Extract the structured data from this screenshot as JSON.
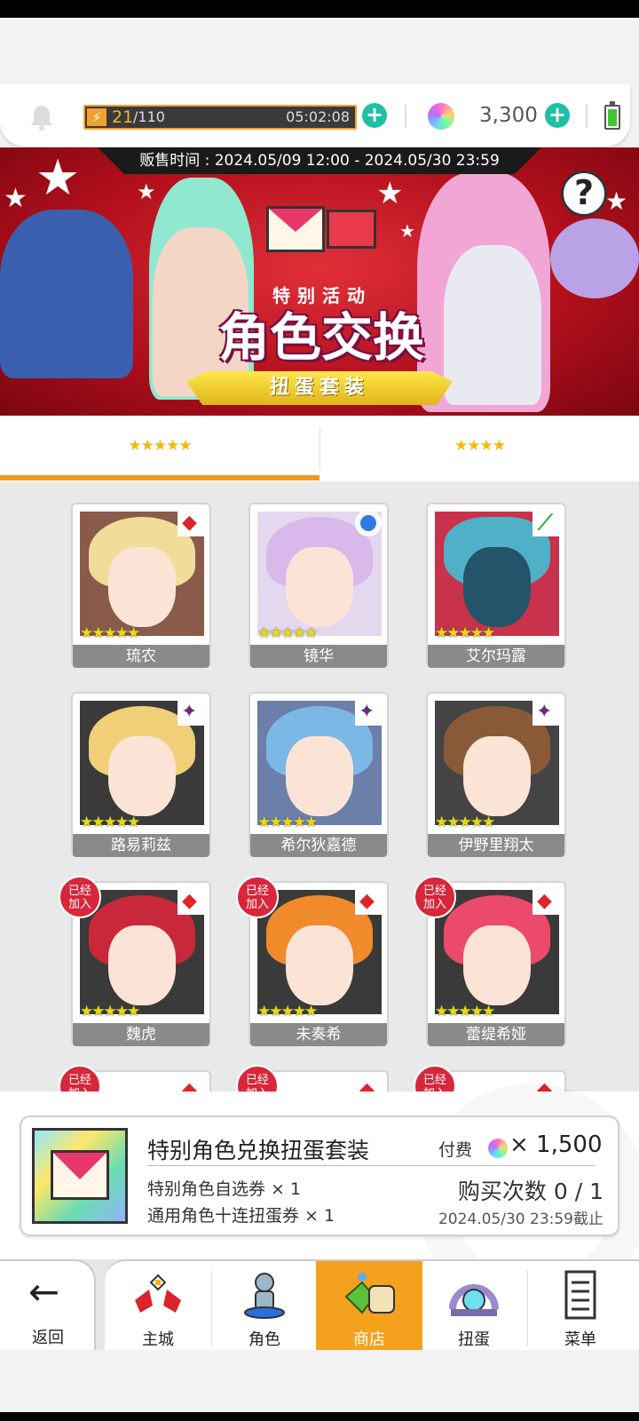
{
  "hud": {
    "stamina_current": "21",
    "stamina_max": "/110",
    "stamina_timer": "05:02:08",
    "gem_count": "3,300"
  },
  "banner": {
    "sale_time": "贩售时间 : 2024.05/09 12:00 - 2024.05/30 23:59",
    "subtitle": "特别活动",
    "title": "角色交换",
    "ribbon": "扭蛋套装"
  },
  "tabs": [
    {
      "label": "★★★★★",
      "active": true
    },
    {
      "label": "★★★★",
      "active": false
    }
  ],
  "characters": [
    {
      "name": "琉农",
      "stars": "★★★★★",
      "badge": "diamond",
      "joined": false
    },
    {
      "name": "镜华",
      "stars": "★★★★★",
      "badge": "blue",
      "joined": false
    },
    {
      "name": "艾尔玛露",
      "stars": "★★★★★",
      "badge": "green",
      "joined": false
    },
    {
      "name": "路易莉兹",
      "stars": "★★★★★",
      "badge": "purple",
      "joined": false
    },
    {
      "name": "希尔狄嘉德",
      "stars": "★★★★★",
      "badge": "purple",
      "joined": false
    },
    {
      "name": "伊野里翔太",
      "stars": "★★★★★",
      "badge": "purple",
      "joined": false
    },
    {
      "name": "魏虎",
      "stars": "★★★★★",
      "badge": "diamond",
      "joined": true
    },
    {
      "name": "未奏希",
      "stars": "★★★★★",
      "badge": "diamond",
      "joined": true
    },
    {
      "name": "蕾缇希娅",
      "stars": "★★★★★",
      "badge": "diamond",
      "joined": true
    }
  ],
  "joined_badge": "已经\n加入",
  "pack": {
    "title": "特别角色兑换扭蛋套装",
    "price_label": "付费",
    "price": "× 1,500",
    "item1": "特别角色自选券 × 1",
    "item2": "通用角色十连扭蛋券 × 1",
    "purchase_count": "购买次数 0 / 1",
    "deadline": "2024.05/30 23:59截止"
  },
  "nav": {
    "back": "返回",
    "items": [
      {
        "label": "主城",
        "icon": "castle-icon"
      },
      {
        "label": "角色",
        "icon": "character-icon"
      },
      {
        "label": "商店",
        "icon": "shop-icon",
        "active": true
      },
      {
        "label": "扭蛋",
        "icon": "gacha-icon"
      },
      {
        "label": "菜单",
        "icon": "menu-icon"
      }
    ]
  },
  "colors": {
    "accent": "#f4a11d",
    "teal": "#1fc0a6",
    "banner_red": "#c01420",
    "joined_red": "#d8263a"
  }
}
